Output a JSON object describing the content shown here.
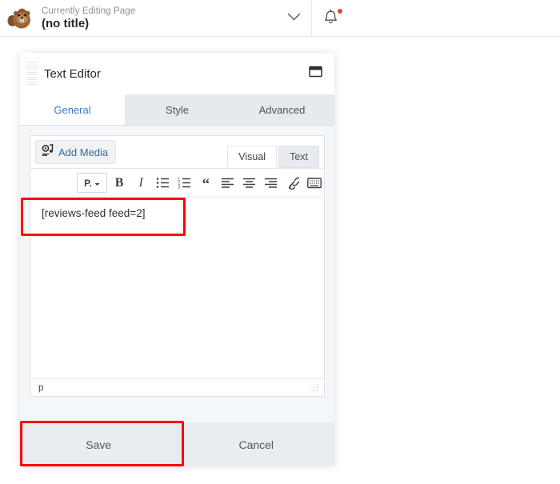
{
  "topbar": {
    "logo_icon": "beaver-logo-icon",
    "eyebrow": "Currently Editing Page",
    "title": "(no title)",
    "chevron_icon": "chevron-down-icon",
    "bell_icon": "bell-icon",
    "notification_dot": true,
    "notification_dot_color": "#e8402a"
  },
  "panel": {
    "drag_handle_icon": "drag-handle-icon",
    "title": "Text Editor",
    "window_icon": "window-icon",
    "tabs": [
      {
        "label": "General",
        "active": true
      },
      {
        "label": "Style",
        "active": false
      },
      {
        "label": "Advanced",
        "active": false
      }
    ],
    "active_tab_color": "#3a7bbf"
  },
  "editor": {
    "add_media": {
      "label": "Add Media",
      "icon": "add-media-icon",
      "color": "#2e6ca4"
    },
    "mode_tabs": [
      {
        "label": "Visual",
        "active": true
      },
      {
        "label": "Text",
        "active": false
      }
    ],
    "toolbar": [
      {
        "name": "paragraph-format-dropdown",
        "label": "P."
      },
      {
        "name": "bold-icon",
        "label": "B"
      },
      {
        "name": "italic-icon",
        "label": "I"
      },
      {
        "name": "unordered-list-icon",
        "label": ""
      },
      {
        "name": "ordered-list-icon",
        "label": ""
      },
      {
        "name": "blockquote-icon",
        "label": "“"
      },
      {
        "name": "align-left-icon",
        "label": ""
      },
      {
        "name": "align-center-icon",
        "label": ""
      },
      {
        "name": "align-right-icon",
        "label": ""
      },
      {
        "name": "link-icon",
        "label": ""
      },
      {
        "name": "keyboard-shortcuts-icon",
        "label": ""
      }
    ],
    "content": "[reviews-feed feed=2]",
    "status_path": "p",
    "resize_handle_icon": "resize-grip-icon"
  },
  "footer": {
    "save_label": "Save",
    "cancel_label": "Cancel"
  },
  "annotations": {
    "color": "#ff0000",
    "boxes": [
      {
        "name": "shortcode-highlight",
        "target": "editor.content"
      },
      {
        "name": "save-button-highlight",
        "target": "footer.save_label"
      }
    ]
  }
}
